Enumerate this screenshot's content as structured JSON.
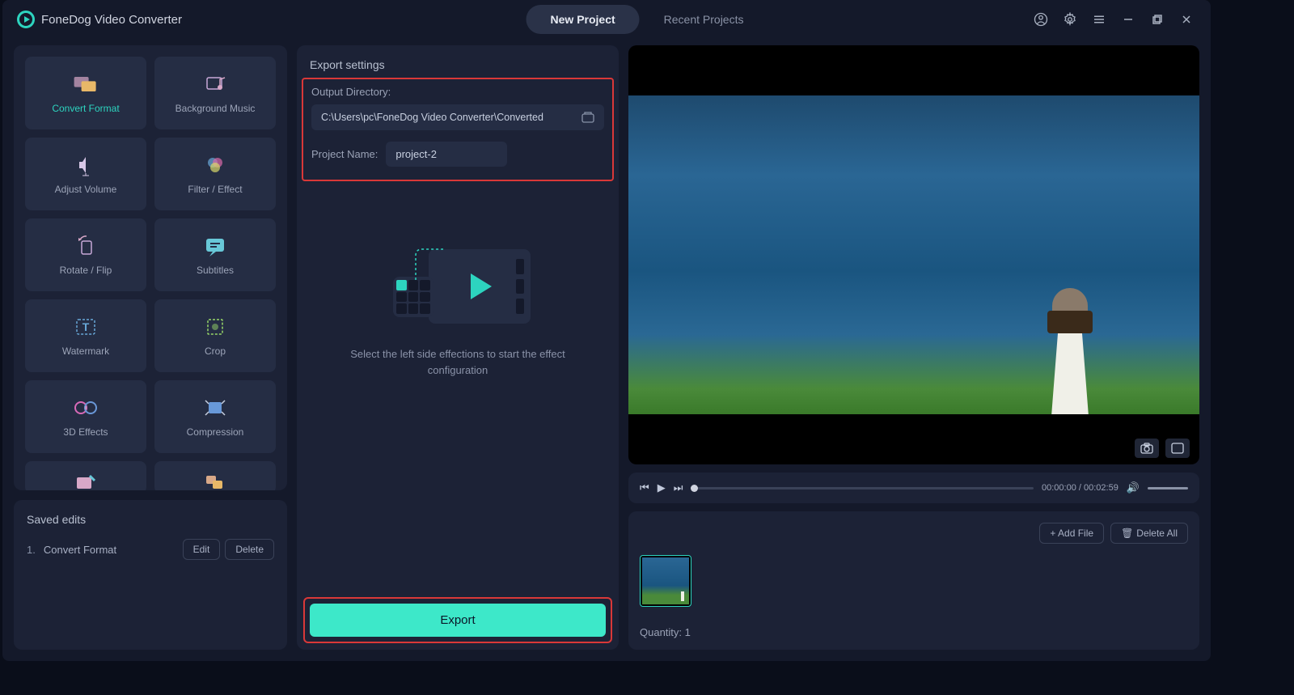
{
  "app": {
    "title": "FoneDog Video Converter"
  },
  "tabs": {
    "new": "New Project",
    "recent": "Recent Projects"
  },
  "tools": [
    {
      "label": "Convert Format"
    },
    {
      "label": "Background Music"
    },
    {
      "label": "Adjust Volume"
    },
    {
      "label": "Filter / Effect"
    },
    {
      "label": "Rotate / Flip"
    },
    {
      "label": "Subtitles"
    },
    {
      "label": "Watermark"
    },
    {
      "label": "Crop"
    },
    {
      "label": "3D Effects"
    },
    {
      "label": "Compression"
    }
  ],
  "saved": {
    "title": "Saved edits",
    "items": [
      {
        "num": "1.",
        "name": "Convert Format"
      }
    ],
    "edit": "Edit",
    "delete": "Delete"
  },
  "export": {
    "title": "Export settings",
    "dir_label": "Output Directory:",
    "dir_path": "C:\\Users\\pc\\FoneDog Video Converter\\Converted",
    "name_label": "Project Name:",
    "name_value": "project-2",
    "placeholder": "Select the left side effections to start the effect configuration",
    "button": "Export"
  },
  "player": {
    "time": "00:00:00 / 00:02:59"
  },
  "files": {
    "add": "Add File",
    "delete_all": "Delete All",
    "quantity_label": "Quantity:",
    "quantity": "1"
  }
}
